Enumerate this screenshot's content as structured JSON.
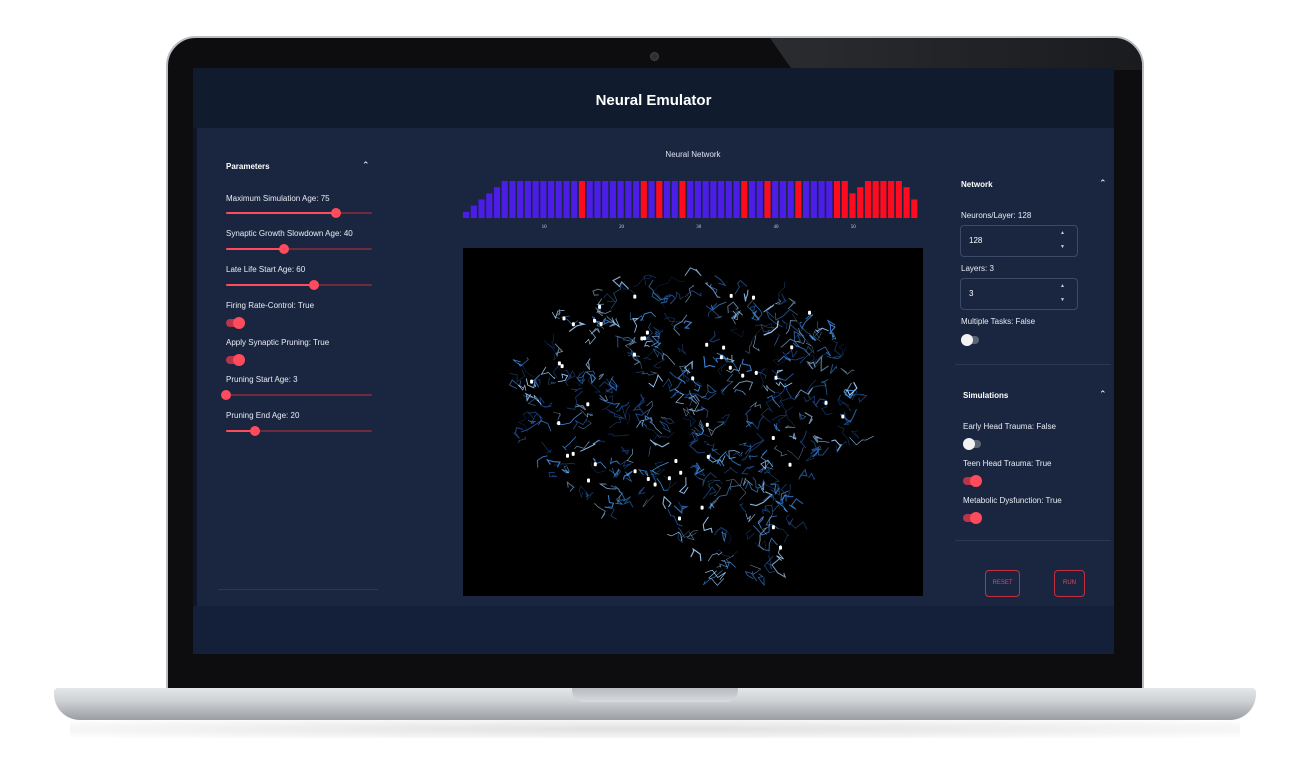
{
  "app": {
    "title": "Neural Emulator"
  },
  "parameters": {
    "title": "Parameters",
    "max_sim_age": {
      "label": "Maximum Simulation Age: 75",
      "value": 75,
      "min": 0,
      "max": 100
    },
    "synaptic_slowdown_age": {
      "label": "Synaptic Growth Slowdown Age: 40",
      "value": 40,
      "min": 0,
      "max": 100
    },
    "late_life_start_age": {
      "label": "Late Life Start Age: 60",
      "value": 60,
      "min": 0,
      "max": 100
    },
    "firing_rate_control": {
      "label": "Firing Rate-Control: True",
      "on": true
    },
    "apply_synaptic_pruning": {
      "label": "Apply Synaptic Pruning: True",
      "on": true
    },
    "pruning_start_age": {
      "label": "Pruning Start Age: 3",
      "value": 3,
      "min": 3,
      "max": 100
    },
    "pruning_end_age": {
      "label": "Pruning End Age: 20",
      "value": 20,
      "min": 0,
      "max": 100
    }
  },
  "center": {
    "title": "Neural Network",
    "chart_data": {
      "type": "bar",
      "x_ticks": [
        "10",
        "20",
        "30",
        "40",
        "50"
      ],
      "values": [
        1,
        2,
        3,
        4,
        5,
        6,
        6,
        6,
        6,
        6,
        6,
        6,
        6,
        6,
        6,
        6,
        6,
        6,
        6,
        6,
        6,
        6,
        6,
        6,
        6,
        6,
        6,
        6,
        6,
        6,
        6,
        6,
        6,
        6,
        6,
        6,
        6,
        6,
        6,
        6,
        6,
        6,
        6,
        6,
        6,
        6,
        6,
        6,
        6,
        6,
        4,
        5,
        6,
        6,
        6,
        6,
        6,
        5,
        3
      ],
      "highlight": [
        15,
        23,
        25,
        28,
        36,
        39,
        43,
        48,
        49,
        50,
        51,
        52,
        53,
        54,
        55,
        56,
        57,
        58,
        58
      ],
      "colors": {
        "normal": "#4b1de6",
        "highlight": "#ff0a1e"
      }
    },
    "image": {
      "description": "brain neural network visualization"
    }
  },
  "network": {
    "title": "Network",
    "neurons": {
      "label": "Neurons/Layer: 128",
      "value": "128"
    },
    "layers": {
      "label": "Layers: 3",
      "value": "3"
    },
    "multiple_tasks": {
      "label": "Multiple Tasks: False",
      "on": false
    }
  },
  "simulations": {
    "title": "Simulations",
    "early_head_trauma": {
      "label": "Early Head Trauma: False",
      "on": false
    },
    "teen_head_trauma": {
      "label": "Teen Head Trauma: True",
      "on": true
    },
    "metabolic_dysfunction": {
      "label": "Metabolic Dysfunction: True",
      "on": true
    }
  },
  "actions": {
    "reset": "RESET",
    "run": "RUN"
  },
  "icons": {
    "collapse": "chevron-up-icon",
    "step_up": "caret-up-icon",
    "step_down": "caret-down-icon"
  }
}
